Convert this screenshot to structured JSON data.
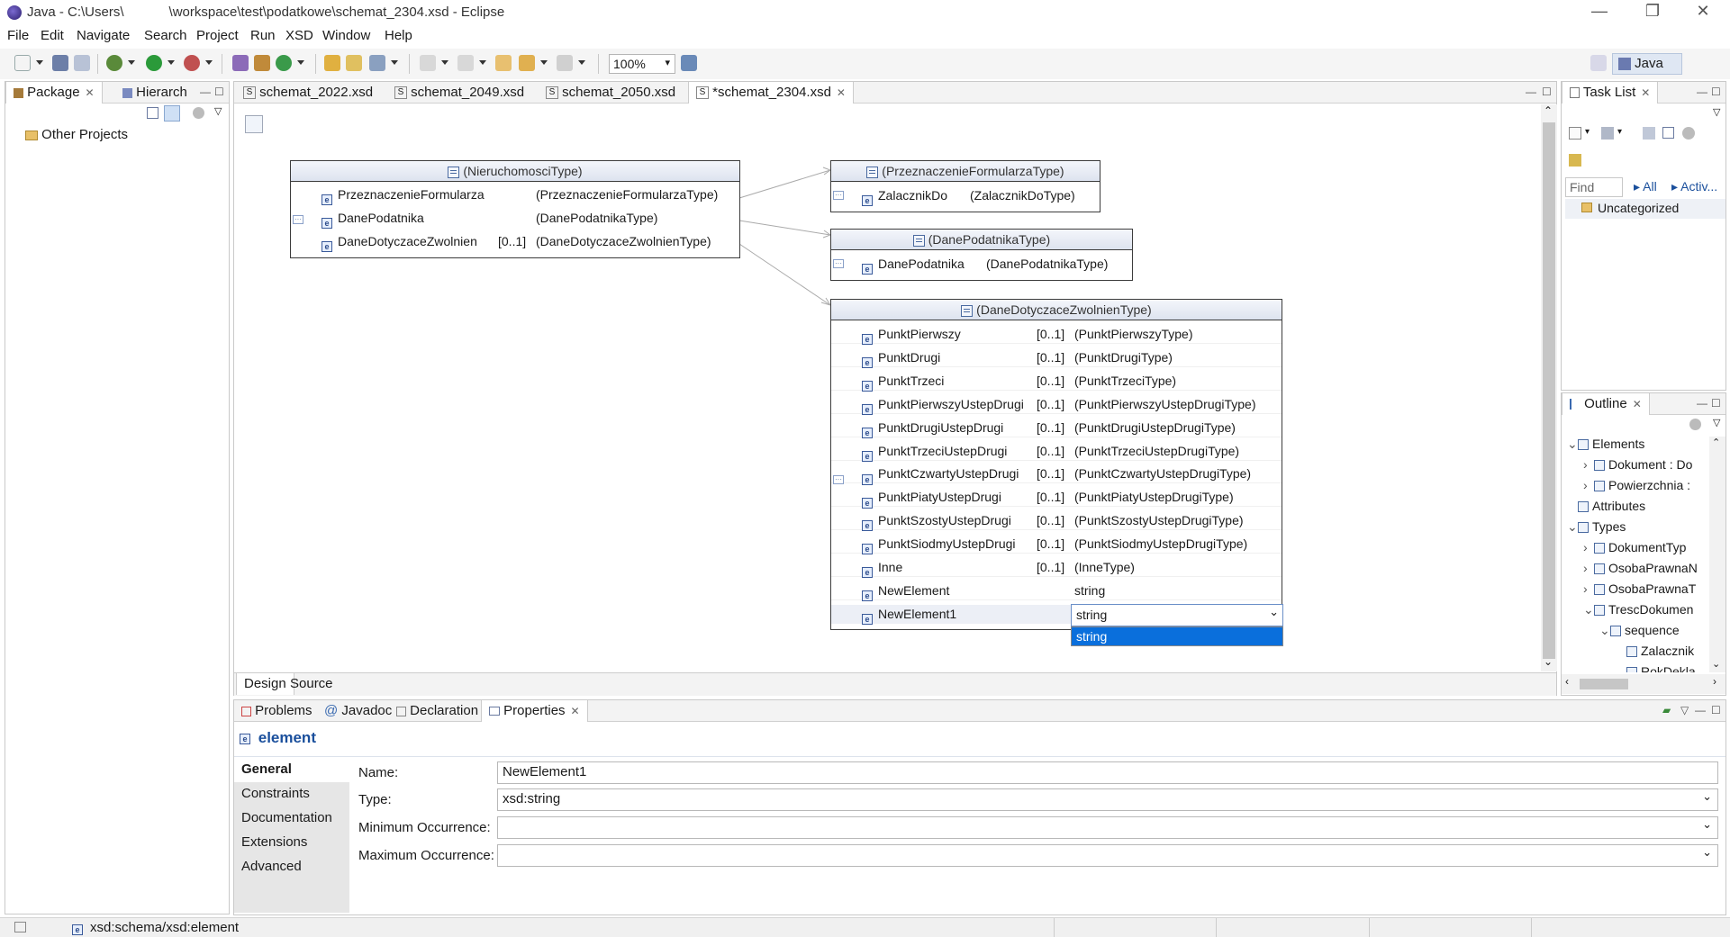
{
  "window": {
    "title": "Java - C:\\Users\\            \\workspace\\test\\podatkowe\\schemat_2304.xsd - Eclipse",
    "controls": [
      "—",
      "❐",
      "✕"
    ]
  },
  "menu": [
    "File",
    "Edit",
    "Navigate",
    "Search",
    "Project",
    "Run",
    "XSD",
    "Window",
    "Help"
  ],
  "toolbar": {
    "zoom": "100%",
    "perspective": "Java"
  },
  "left_pane": {
    "tabs": [
      "Package",
      "Hierarch"
    ],
    "tree": [
      {
        "label": "Other Projects"
      }
    ]
  },
  "editor": {
    "tabs": [
      "schemat_2022.xsd",
      "schemat_2049.xsd",
      "schemat_2050.xsd",
      "*schemat_2304.xsd"
    ],
    "bottom_tabs": [
      "Design",
      "Source"
    ],
    "diagram": {
      "nieruchomosci": {
        "title": "(NieruchomosciType)",
        "rows": [
          {
            "name": "PrzeznaczenieFormularza",
            "occ": "",
            "type": "(PrzeznaczenieFormularzaType)"
          },
          {
            "name": "DanePodatnika",
            "occ": "",
            "type": "(DanePodatnikaType)"
          },
          {
            "name": "DaneDotyczaceZwolnien",
            "occ": "[0..1]",
            "type": "(DaneDotyczaceZwolnienType)"
          }
        ]
      },
      "przeznaczenie": {
        "title": "(PrzeznaczenieFormularzaType)",
        "rows": [
          {
            "name": "ZalacznikDo",
            "occ": "",
            "type": "(ZalacznikDoType)"
          }
        ]
      },
      "danepodatnika": {
        "title": "(DanePodatnikaType)",
        "rows": [
          {
            "name": "DanePodatnika",
            "occ": "",
            "type": "(DanePodatnikaType)"
          }
        ]
      },
      "zwolnienia": {
        "title": "(DaneDotyczaceZwolnienType)",
        "rows": [
          {
            "name": "PunktPierwszy",
            "occ": "[0..1]",
            "type": "(PunktPierwszyType)"
          },
          {
            "name": "PunktDrugi",
            "occ": "[0..1]",
            "type": "(PunktDrugiType)"
          },
          {
            "name": "PunktTrzeci",
            "occ": "[0..1]",
            "type": "(PunktTrzeciType)"
          },
          {
            "name": "PunktPierwszyUstepDrugi",
            "occ": "[0..1]",
            "type": "(PunktPierwszyUstepDrugiType)"
          },
          {
            "name": "PunktDrugiUstepDrugi",
            "occ": "[0..1]",
            "type": "(PunktDrugiUstepDrugiType)"
          },
          {
            "name": "PunktTrzeciUstepDrugi",
            "occ": "[0..1]",
            "type": "(PunktTrzeciUstepDrugiType)"
          },
          {
            "name": "PunktCzwartyUstepDrugi",
            "occ": "[0..1]",
            "type": "(PunktCzwartyUstepDrugiType)"
          },
          {
            "name": "PunktPiatyUstepDrugi",
            "occ": "[0..1]",
            "type": "(PunktPiatyUstepDrugiType)"
          },
          {
            "name": "PunktSzostyUstepDrugi",
            "occ": "[0..1]",
            "type": "(PunktSzostyUstepDrugiType)"
          },
          {
            "name": "PunktSiodmyUstepDrugi",
            "occ": "[0..1]",
            "type": "(PunktSiodmyUstepDrugiType)"
          },
          {
            "name": "Inne",
            "occ": "[0..1]",
            "type": "(InneType)"
          },
          {
            "name": "NewElement",
            "occ": "",
            "type": "string"
          }
        ],
        "editing_row": {
          "name": "NewElement1",
          "combo_value": "string",
          "dropdown_option": "string"
        }
      }
    }
  },
  "task_list": {
    "title": "Task List",
    "find_placeholder": "Find",
    "all_label": "All",
    "activate_label": "Activ...",
    "category": "Uncategorized"
  },
  "outline": {
    "title": "Outline",
    "tree": [
      {
        "label": "Elements",
        "level": 0,
        "expander": "v"
      },
      {
        "label": "Dokument : Do",
        "level": 1,
        "expander": ">"
      },
      {
        "label": "Powierzchnia : ",
        "level": 1,
        "expander": ">"
      },
      {
        "label": "Attributes",
        "level": 0,
        "expander": ""
      },
      {
        "label": "Types",
        "level": 0,
        "expander": "v"
      },
      {
        "label": "DokumentTyp",
        "level": 1,
        "expander": ">"
      },
      {
        "label": "OsobaPrawnaN",
        "level": 1,
        "expander": ">"
      },
      {
        "label": "OsobaPrawnaT",
        "level": 1,
        "expander": ">"
      },
      {
        "label": "TrescDokumen",
        "level": 1,
        "expander": "v"
      },
      {
        "label": "sequence",
        "level": 2,
        "expander": "v"
      },
      {
        "label": "Zalacznik",
        "level": 3,
        "expander": ""
      },
      {
        "label": "RokDekla",
        "level": 3,
        "expander": ""
      }
    ]
  },
  "bottom_panel": {
    "tabs": [
      "Problems",
      "Javadoc",
      "Declaration",
      "Properties"
    ],
    "heading": "element",
    "sections": [
      "General",
      "Constraints",
      "Documentation",
      "Extensions",
      "Advanced"
    ],
    "fields": {
      "name_label": "Name:",
      "name_value": "NewElement1",
      "type_label": "Type:",
      "type_value": "xsd:string",
      "min_label": "Minimum Occurrence:",
      "min_value": "",
      "max_label": "Maximum Occurrence:",
      "max_value": ""
    }
  },
  "status_bar": {
    "path": "xsd:schema/xsd:element"
  },
  "colors": {
    "selection": "#0a6fdc",
    "diagram_header": "#dde3ef",
    "link": "#1a4f9c"
  }
}
